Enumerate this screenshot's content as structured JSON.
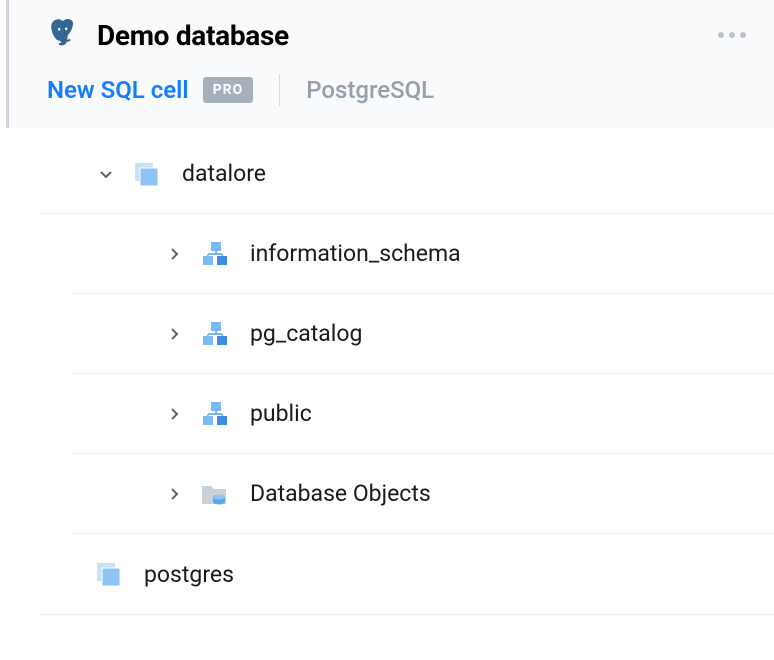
{
  "header": {
    "title": "Demo database"
  },
  "actions": {
    "new_cell_label": "New SQL cell",
    "pro_badge": "PRO",
    "db_type": "PostgreSQL"
  },
  "tree": {
    "root": {
      "label": "datalore",
      "expanded": true
    },
    "children": [
      {
        "label": "information_schema",
        "icon": "schema"
      },
      {
        "label": "pg_catalog",
        "icon": "schema"
      },
      {
        "label": "public",
        "icon": "schema"
      },
      {
        "label": "Database Objects",
        "icon": "db-objects"
      }
    ],
    "sibling": {
      "label": "postgres"
    }
  },
  "colors": {
    "accent_blue": "#167dff",
    "icon_blue": "#7bb8f5",
    "icon_blue_dark": "#3a8de0",
    "muted": "#a6b0bb"
  }
}
